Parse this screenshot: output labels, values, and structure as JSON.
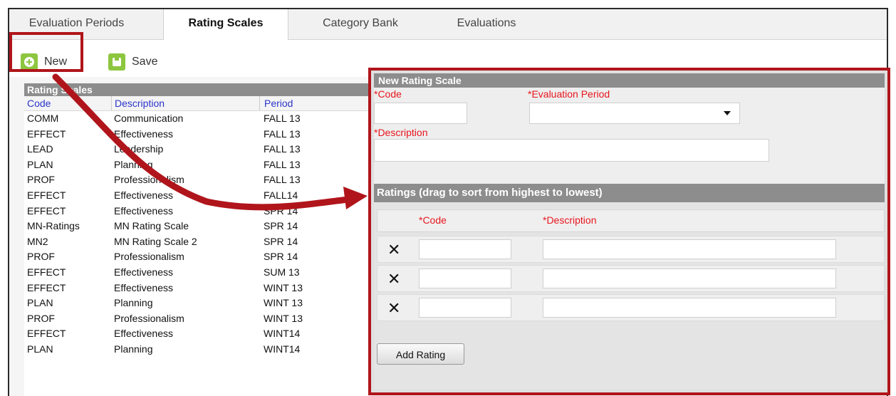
{
  "tabs": [
    {
      "label": "Evaluation Periods",
      "active": false
    },
    {
      "label": "Rating Scales",
      "active": true
    },
    {
      "label": "Category Bank",
      "active": false
    },
    {
      "label": "Evaluations",
      "active": false
    }
  ],
  "toolbar": {
    "new_label": "New",
    "save_label": "Save"
  },
  "rating_scales": {
    "title": "Rating Scales",
    "columns": [
      "Code",
      "Description",
      "Period"
    ],
    "rows": [
      [
        "COMM",
        "Communication",
        "FALL 13"
      ],
      [
        "EFFECT",
        "Effectiveness",
        "FALL 13"
      ],
      [
        "LEAD",
        "Leadership",
        "FALL 13"
      ],
      [
        "PLAN",
        "Planning",
        "FALL 13"
      ],
      [
        "PROF",
        "Professionalism",
        "FALL 13"
      ],
      [
        "EFFECT",
        "Effectiveness",
        "FALL14"
      ],
      [
        "EFFECT",
        "Effectiveness",
        "SPR 14"
      ],
      [
        "MN-Ratings",
        "MN Rating Scale",
        "SPR 14"
      ],
      [
        "MN2",
        "MN Rating Scale 2",
        "SPR 14"
      ],
      [
        "PROF",
        "Professionalism",
        "SPR 14"
      ],
      [
        "EFFECT",
        "Effectiveness",
        "SUM 13"
      ],
      [
        "EFFECT",
        "Effectiveness",
        "WINT 13"
      ],
      [
        "PLAN",
        "Planning",
        "WINT 13"
      ],
      [
        "PROF",
        "Professionalism",
        "WINT 13"
      ],
      [
        "EFFECT",
        "Effectiveness",
        "WINT14"
      ],
      [
        "PLAN",
        "Planning",
        "WINT14"
      ]
    ]
  },
  "new_scale": {
    "title": "New Rating Scale",
    "code_label": "*Code",
    "period_label": "*Evaluation Period",
    "description_label": "*Description",
    "code_value": "",
    "description_value": "",
    "period_value": ""
  },
  "ratings": {
    "title": "Ratings (drag to sort from highest to lowest)",
    "code_header": "*Code",
    "description_header": "*Description",
    "rows": [
      {
        "code": "",
        "description": ""
      },
      {
        "code": "",
        "description": ""
      },
      {
        "code": "",
        "description": ""
      }
    ],
    "add_label": "Add Rating"
  },
  "colors": {
    "accent_green": "#8dc63f",
    "highlight_red": "#b0151b",
    "required_red": "#e8151d",
    "header_gray": "#8d8d8d"
  },
  "icons": {
    "new": "plus-circle-icon",
    "save": "floppy-disk-icon",
    "remove": "x-icon",
    "dropdown": "caret-down-icon"
  }
}
